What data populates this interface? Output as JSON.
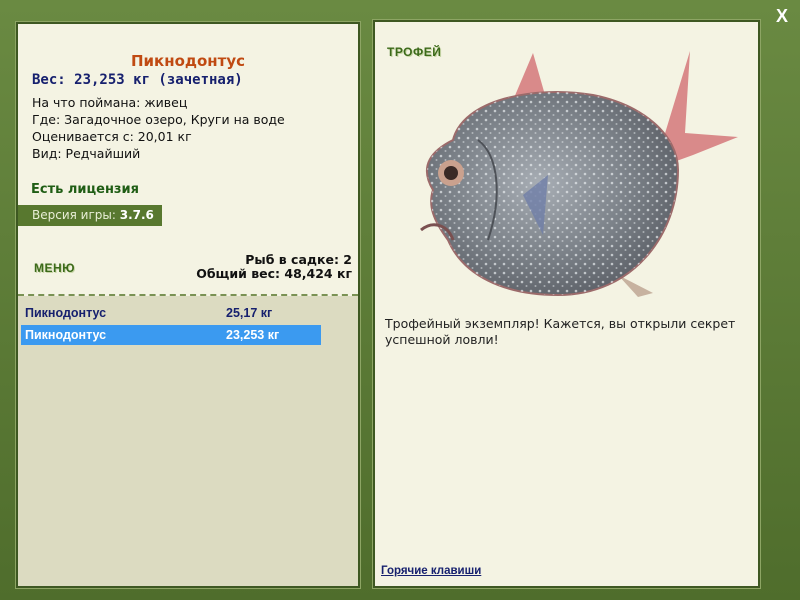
{
  "window": {
    "close_label": "X"
  },
  "fish": {
    "name": "Пикнодонтус",
    "weight_line": "Вес: 23,253 кг (зачетная)",
    "info": [
      "На что поймана: живец",
      "Где: Загадочное озеро, Круги на воде",
      "Оценивается с: 20,01 кг",
      "Вид: Редчайший"
    ]
  },
  "license": "Есть лицензия",
  "version": {
    "label": "Версия игры:",
    "value": "3.7.6"
  },
  "menu_label": "МЕНЮ",
  "cage": {
    "count_line": "Рыб в садке: 2",
    "total_line": "Общий вес: 48,424 кг"
  },
  "catch_list": [
    {
      "name": "Пикнодонтус",
      "weight": "25,17 кг",
      "selected": false
    },
    {
      "name": "Пикнодонтус",
      "weight": "23,253 кг",
      "selected": true
    }
  ],
  "trophy": {
    "label": "ТРОФЕЙ",
    "description": "Трофейный экземпляр! Кажется, вы открыли секрет успешной ловли!"
  },
  "hotkeys_label": "Горячие клавиши",
  "colors": {
    "frame": "#5a7a34",
    "panel": "#f4f3e3",
    "selection": "#3b9af0",
    "title": "#c04a12",
    "navy": "#16206e"
  }
}
